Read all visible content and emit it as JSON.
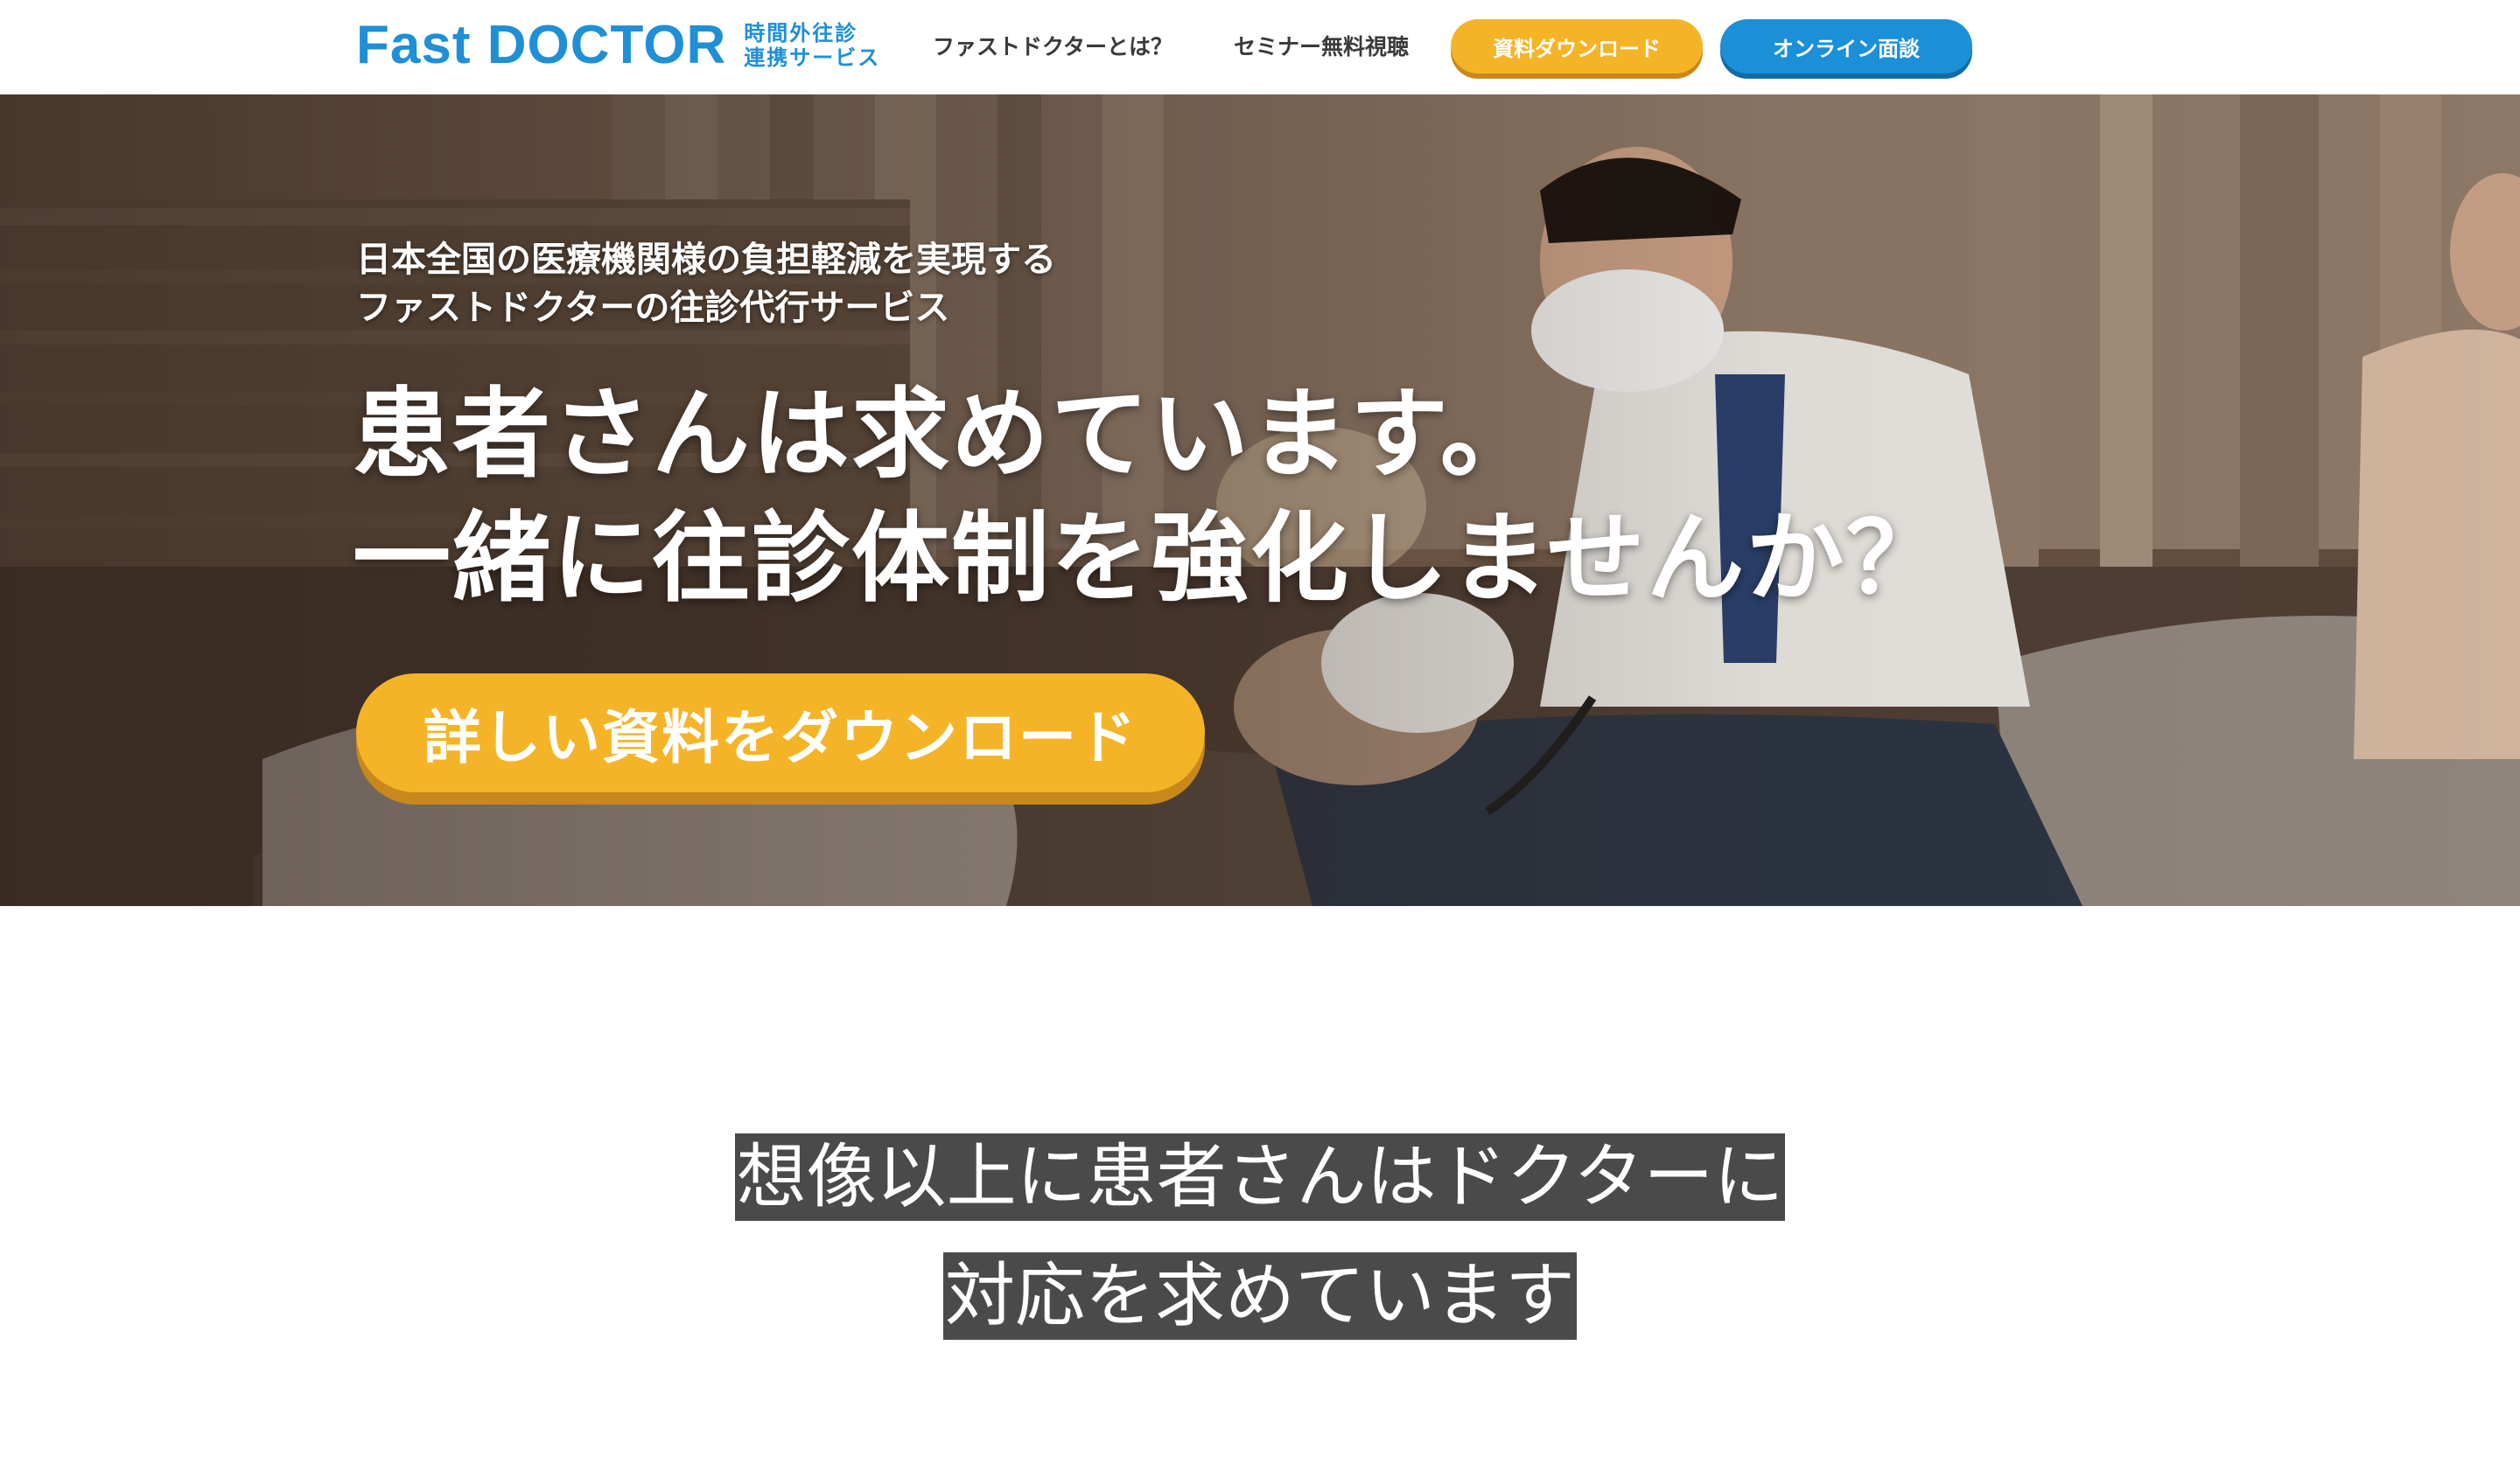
{
  "header": {
    "logo_text": "Fast DOCTOR",
    "logo_sub_line1": "時間外往診",
    "logo_sub_line2": "連携サービス",
    "nav": {
      "about": "ファストドクターとは？",
      "seminar": "セミナー無料視聴"
    },
    "buttons": {
      "download": "資料ダウンロード",
      "online": "オンライン面談"
    },
    "colors": {
      "brand_blue": "#1f8fd6",
      "accent_yellow": "#f5b427"
    }
  },
  "hero": {
    "lead_line1": "日本全国の医療機関様の負担軽減を実現する",
    "lead_line2": "ファストドクターの往診代行サービス",
    "title_line1": "患者さんは求めています。",
    "title_line2": "一緒に往診体制を強化しませんか？",
    "cta_label": "詳しい資料をダウンロード"
  },
  "section2": {
    "line1": "想像以上に患者さんはドクターに",
    "line2": "対応を求めています"
  }
}
